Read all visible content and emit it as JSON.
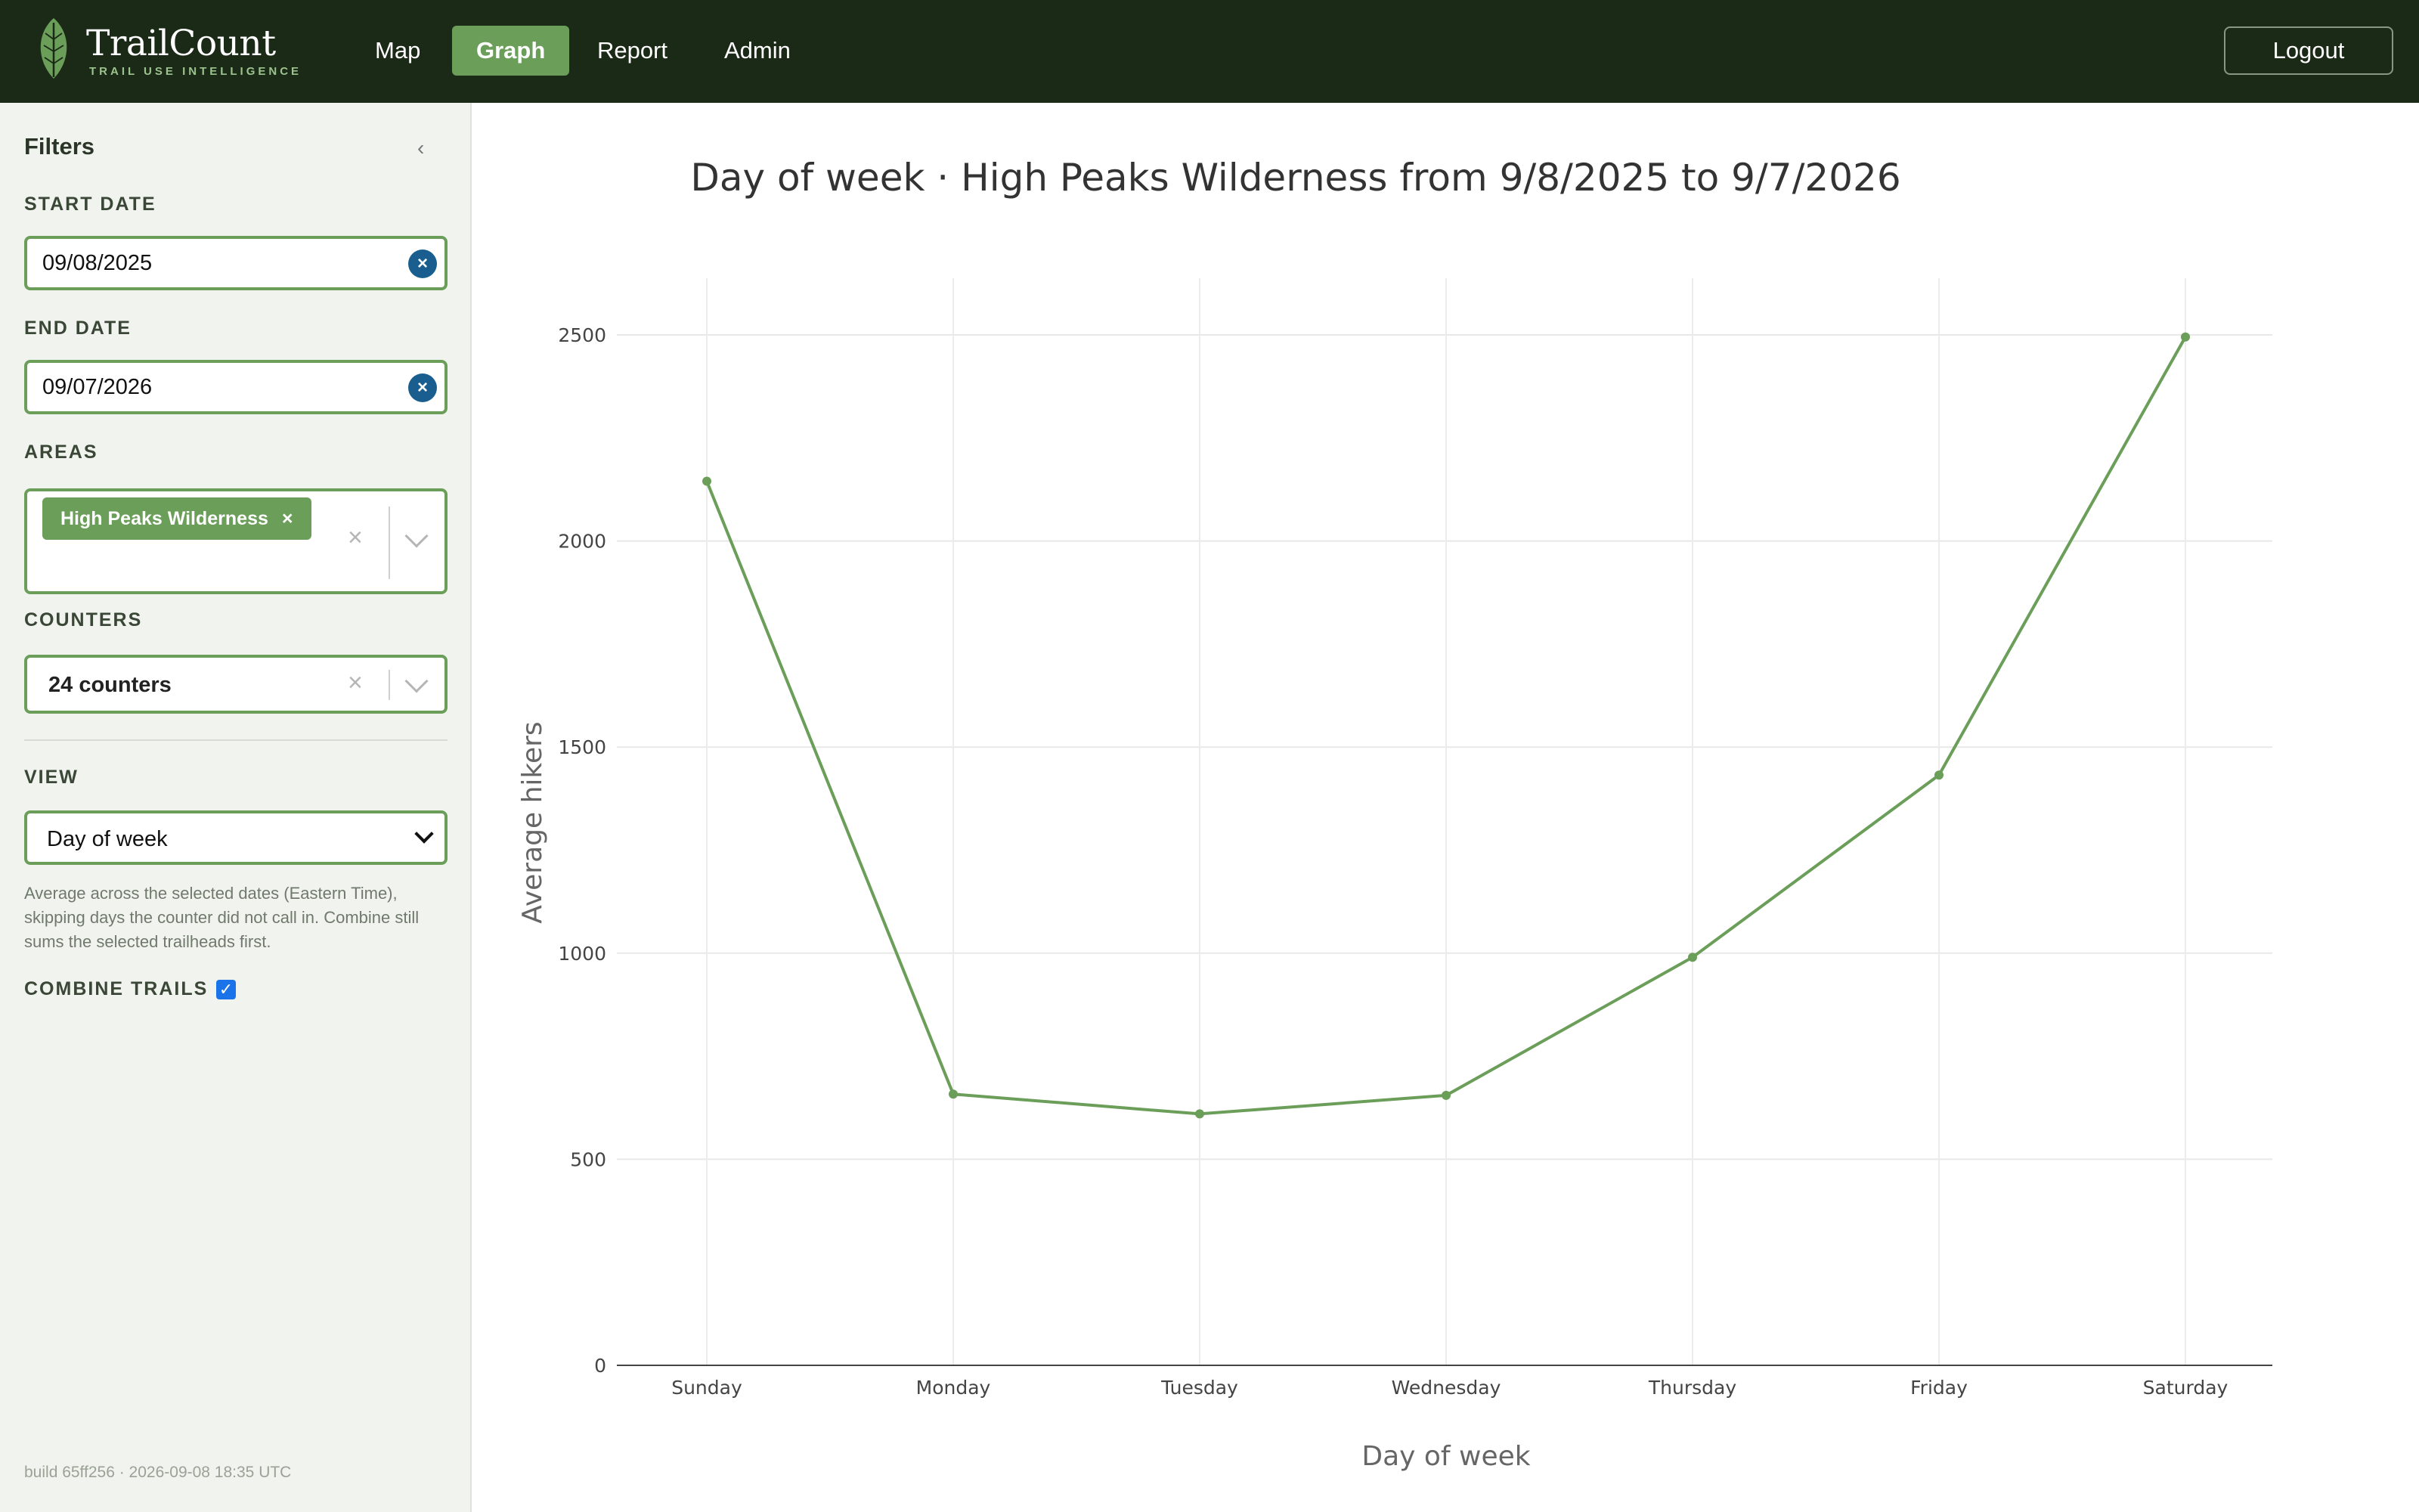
{
  "header": {
    "brand": "TrailCount",
    "tagline": "TRAIL USE INTELLIGENCE",
    "nav": [
      "Map",
      "Graph",
      "Report",
      "Admin"
    ],
    "active_tab": "Graph",
    "logout": "Logout"
  },
  "sidebar": {
    "title": "Filters",
    "start_date_label": "START DATE",
    "start_date": "09/08/2025",
    "end_date_label": "END DATE",
    "end_date": "09/07/2026",
    "areas_label": "AREAS",
    "area_chip": "High Peaks Wilderness",
    "counters_label": "COUNTERS",
    "counters_value": "24 counters",
    "view_label": "VIEW",
    "view_value": "Day of week",
    "help": "Average across the selected dates (Eastern Time), skipping days the counter did not call in. Combine still sums the selected trailheads first.",
    "combine_label": "COMBINE TRAILS",
    "build": "build 65ff256 · 2026-09-08 18:35 UTC"
  },
  "colors": {
    "nav_bg": "#1b2a16",
    "accent": "#6a9e59",
    "clear_button": "#1a5e8f"
  },
  "chart_data": {
    "type": "line",
    "title": "Day of week · High Peaks Wilderness from 9/8/2025 to 9/7/2026",
    "xlabel": "Day of week",
    "ylabel": "Average hikers",
    "categories": [
      "Sunday",
      "Monday",
      "Tuesday",
      "Wednesday",
      "Thursday",
      "Friday",
      "Saturday"
    ],
    "values": [
      2145,
      658,
      610,
      655,
      990,
      1432,
      2495
    ],
    "ylim": [
      0,
      2500
    ],
    "yticks": [
      0,
      500,
      1000,
      1500,
      2000,
      2500
    ],
    "grid": true,
    "color": "#6a9e59"
  }
}
